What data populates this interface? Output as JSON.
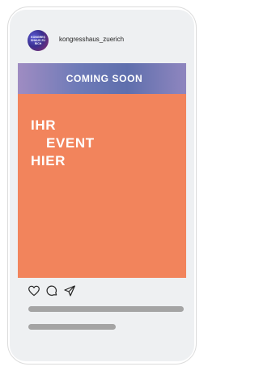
{
  "profile": {
    "username": "kongresshaus_zuerich",
    "avatar_text": "KONGRESSHAUS ZÜRICH"
  },
  "post": {
    "banner": "COMING SOON",
    "lines": [
      "IHR",
      "EVENT",
      "HIER"
    ]
  },
  "actions": {
    "icons": [
      "heart-icon",
      "comment-icon",
      "share-icon"
    ]
  },
  "colors": {
    "post_background": "#f2845c",
    "screen_background": "#eef0f2",
    "placeholder_bar": "#a4a4a4"
  }
}
